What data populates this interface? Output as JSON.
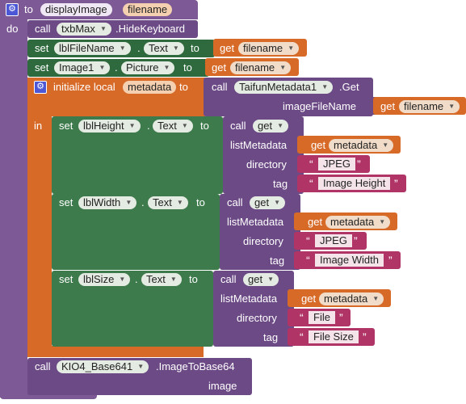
{
  "proc": {
    "to": "to",
    "name": "displayImage",
    "param": "filename",
    "do": "do"
  },
  "call": "call",
  "set": "set",
  "get": "get",
  "to": "to",
  "dot": ".",
  "hidekb": {
    "component": "txbMax",
    "method": ".HideKeyboard"
  },
  "set1": {
    "component": "lblFileName",
    "prop": "Text",
    "var": "filename"
  },
  "set2": {
    "component": "Image1",
    "prop": "Picture",
    "var": "filename"
  },
  "local": {
    "label": "initialize local",
    "name": "metadata",
    "to": "to",
    "component": "TaifunMetadata1",
    "method": ".Get",
    "argname": "imageFileName",
    "argvar": "filename"
  },
  "in": "in",
  "sets": [
    {
      "component": "lblHeight",
      "prop": "Text",
      "getname": "get",
      "l1": "listMetadata",
      "var": "metadata",
      "l2": "directory",
      "dir": "JPEG",
      "l3": "tag",
      "tag": "Image Height"
    },
    {
      "component": "lblWidth",
      "prop": "Text",
      "getname": "get",
      "l1": "listMetadata",
      "var": "metadata",
      "l2": "directory",
      "dir": "JPEG",
      "l3": "tag",
      "tag": "Image Width"
    },
    {
      "component": "lblSize",
      "prop": "Text",
      "getname": "get",
      "l1": "listMetadata",
      "var": "metadata",
      "l2": "directory",
      "dir": "File",
      "l3": "tag",
      "tag": "File Size"
    }
  ],
  "base64": {
    "component": "KIO4_Base641",
    "method": ".ImageToBase64",
    "arg": "image"
  }
}
